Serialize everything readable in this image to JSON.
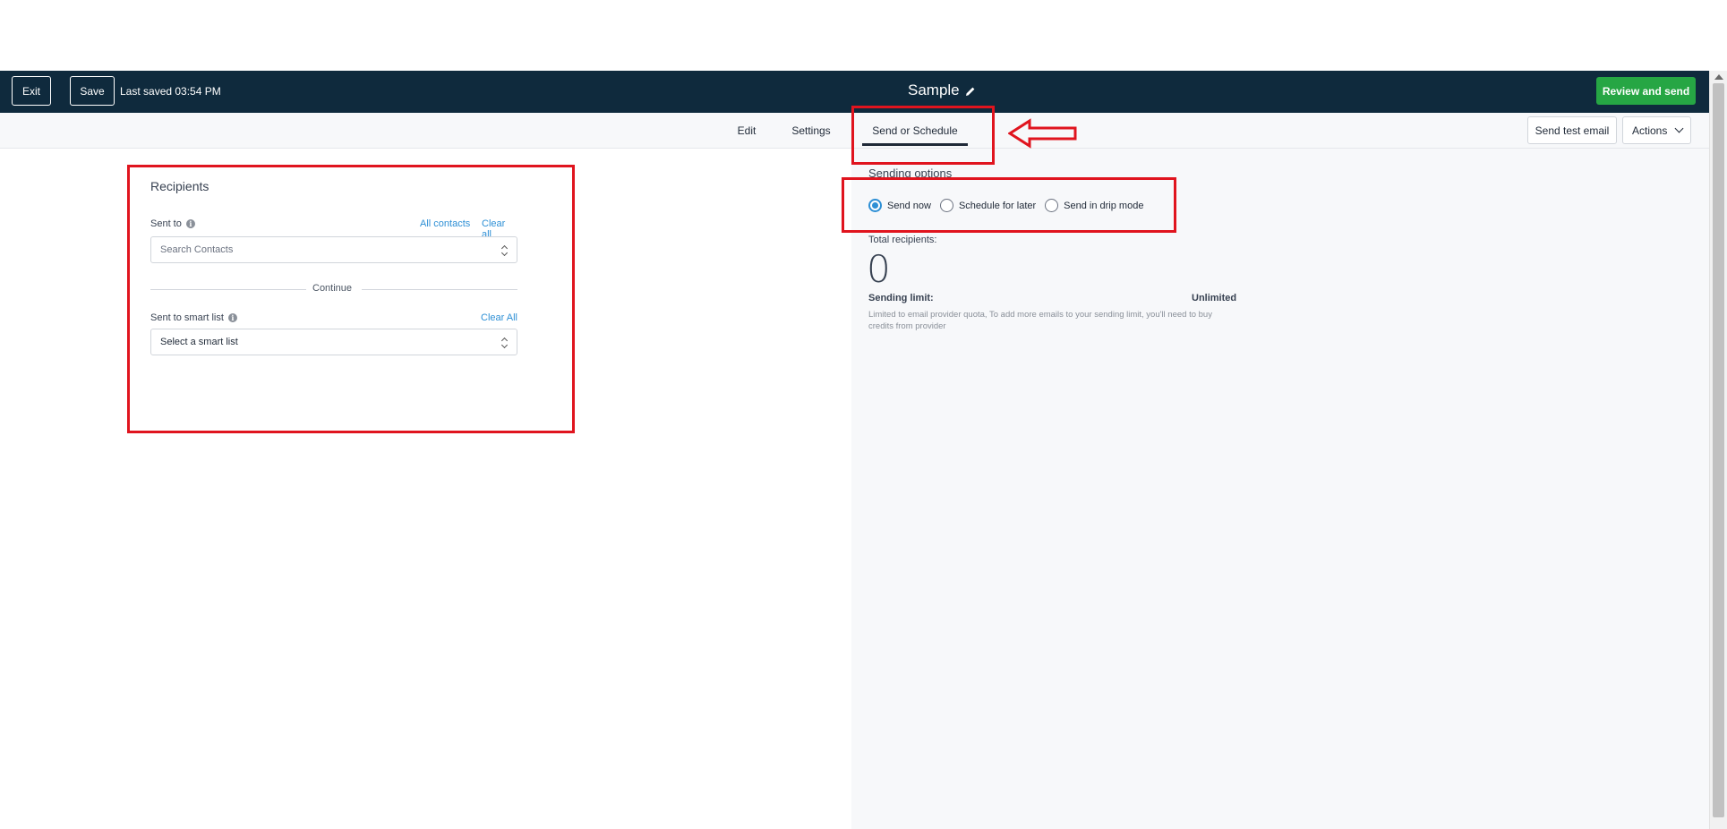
{
  "header": {
    "exit_label": "Exit",
    "save_label": "Save",
    "last_saved": "Last saved 03:54 PM",
    "title": "Sample",
    "review_label": "Review and send"
  },
  "tabs": [
    {
      "label": "Edit"
    },
    {
      "label": "Settings"
    },
    {
      "label": "Send or Schedule",
      "active": true
    }
  ],
  "toolbar": {
    "send_test_label": "Send test email",
    "actions_label": "Actions"
  },
  "recipients": {
    "title": "Recipients",
    "sent_to_label": "Sent to",
    "all_contacts": "All contacts",
    "clear_all": "Clear all",
    "search_placeholder": "Search Contacts",
    "divider_text": "Continue",
    "smart_list_label": "Sent to smart list",
    "smart_clear_all": "Clear All",
    "smart_list_value": "Select a smart list"
  },
  "sending": {
    "title": "Sending options",
    "options": [
      {
        "label": "Send now",
        "checked": true
      },
      {
        "label": "Schedule for later",
        "checked": false
      },
      {
        "label": "Send in drip mode",
        "checked": false
      }
    ],
    "total_label": "Total recipients:",
    "total_value": "0",
    "limit_label": "Sending limit:",
    "limit_value": "Unlimited",
    "limit_note": "Limited to email provider quota, To add more emails to your sending limit, you'll need to buy credits from provider"
  },
  "colors": {
    "topbar": "#0f2a3d",
    "review_button": "#26a644",
    "link": "#2d8fd5",
    "annotation": "#e0141e"
  }
}
